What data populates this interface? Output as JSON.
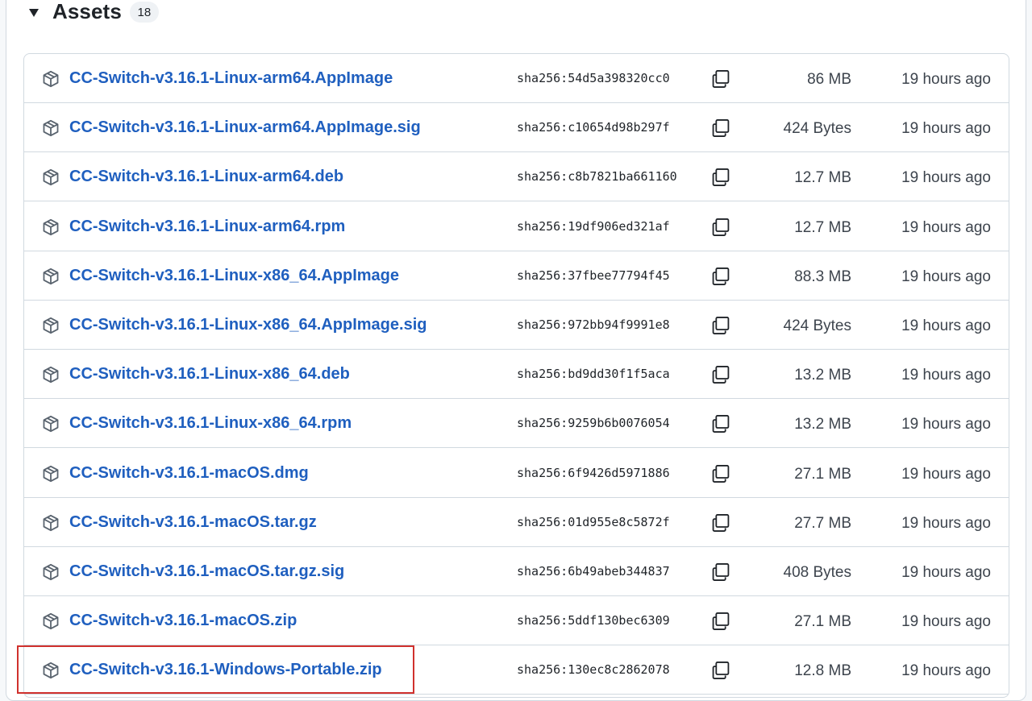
{
  "assets": {
    "title": "Assets",
    "count": "18",
    "items": [
      {
        "name": "CC-Switch-v3.16.1-Linux-arm64.AppImage",
        "digest": "sha256:54d5a398320cc0",
        "size": "86 MB",
        "updated": "19 hours ago"
      },
      {
        "name": "CC-Switch-v3.16.1-Linux-arm64.AppImage.sig",
        "digest": "sha256:c10654d98b297f",
        "size": "424 Bytes",
        "updated": "19 hours ago"
      },
      {
        "name": "CC-Switch-v3.16.1-Linux-arm64.deb",
        "digest": "sha256:c8b7821ba661160",
        "size": "12.7 MB",
        "updated": "19 hours ago"
      },
      {
        "name": "CC-Switch-v3.16.1-Linux-arm64.rpm",
        "digest": "sha256:19df906ed321af",
        "size": "12.7 MB",
        "updated": "19 hours ago"
      },
      {
        "name": "CC-Switch-v3.16.1-Linux-x86_64.AppImage",
        "digest": "sha256:37fbee77794f45",
        "size": "88.3 MB",
        "updated": "19 hours ago"
      },
      {
        "name": "CC-Switch-v3.16.1-Linux-x86_64.AppImage.sig",
        "digest": "sha256:972bb94f9991e8",
        "size": "424 Bytes",
        "updated": "19 hours ago"
      },
      {
        "name": "CC-Switch-v3.16.1-Linux-x86_64.deb",
        "digest": "sha256:bd9dd30f1f5aca",
        "size": "13.2 MB",
        "updated": "19 hours ago"
      },
      {
        "name": "CC-Switch-v3.16.1-Linux-x86_64.rpm",
        "digest": "sha256:9259b6b0076054",
        "size": "13.2 MB",
        "updated": "19 hours ago"
      },
      {
        "name": "CC-Switch-v3.16.1-macOS.dmg",
        "digest": "sha256:6f9426d5971886",
        "size": "27.1 MB",
        "updated": "19 hours ago"
      },
      {
        "name": "CC-Switch-v3.16.1-macOS.tar.gz",
        "digest": "sha256:01d955e8c5872f",
        "size": "27.7 MB",
        "updated": "19 hours ago"
      },
      {
        "name": "CC-Switch-v3.16.1-macOS.tar.gz.sig",
        "digest": "sha256:6b49abeb344837",
        "size": "408 Bytes",
        "updated": "19 hours ago"
      },
      {
        "name": "CC-Switch-v3.16.1-macOS.zip",
        "digest": "sha256:5ddf130bec6309",
        "size": "27.1 MB",
        "updated": "19 hours ago"
      },
      {
        "name": "CC-Switch-v3.16.1-Windows-Portable.zip",
        "digest": "sha256:130ec8c2862078",
        "size": "12.8 MB",
        "updated": "19 hours ago"
      }
    ]
  },
  "colors": {
    "link": "#1f5fbf",
    "highlight": "#d0312d"
  },
  "icons": {
    "row_icon": "package-icon",
    "copy_icon": "copy-icon",
    "header_icon": "triangle-down-icon"
  }
}
